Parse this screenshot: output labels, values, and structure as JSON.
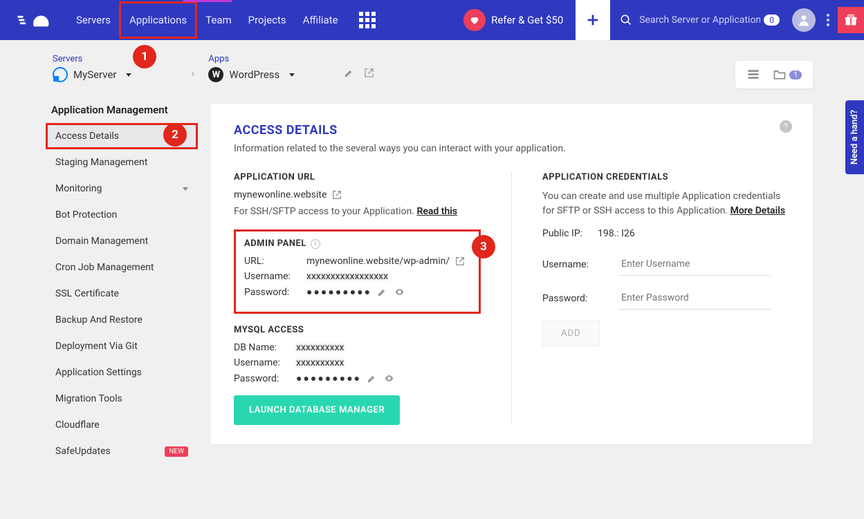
{
  "nav": {
    "links": [
      "Servers",
      "Applications",
      "Team",
      "Projects",
      "Affiliate"
    ],
    "refer": "Refer & Get $50",
    "search_placeholder": "Search Server or Application",
    "search_count": "0"
  },
  "crumb": {
    "servers_label": "Servers",
    "server_name": "MyServer",
    "apps_label": "Apps",
    "app_name": "WordPress",
    "folder_count": "1"
  },
  "callouts": {
    "c1": "1",
    "c2": "2",
    "c3": "3"
  },
  "sidebar": {
    "title": "Application Management",
    "items": [
      "Access Details",
      "Staging Management",
      "Monitoring",
      "Bot Protection",
      "Domain Management",
      "Cron Job Management",
      "SSL Certificate",
      "Backup And Restore",
      "Deployment Via Git",
      "Application Settings",
      "Migration Tools",
      "Cloudflare",
      "SafeUpdates"
    ],
    "new_badge": "NEW"
  },
  "panel": {
    "title": "ACCESS DETAILS",
    "sub": "Information related to the several ways you can interact with your application.",
    "app_url_title": "APPLICATION URL",
    "app_url": "mynewonline.website",
    "ssh_note": "For SSH/SFTP access to your Application. ",
    "read_this": "Read this",
    "admin_title": "ADMIN PANEL",
    "admin_url_label": "URL:",
    "admin_url": "mynewonline.website/wp-admin/",
    "username_label": "Username:",
    "admin_username_masked": "xxxxxxxxxxxxxxxxx",
    "password_label": "Password:",
    "password_dots": "●●●●●●●●●",
    "mysql_title": "MYSQL ACCESS",
    "db_name_label": "DB Name:",
    "db_name_masked": "xxxxxxxxxx",
    "mysql_user_masked": "xxxxxxxxxx",
    "launch_db": "LAUNCH DATABASE MANAGER",
    "cred_title": "APPLICATION CREDENTIALS",
    "cred_note": "You can create and use multiple Application credentials for SFTP or SSH access to this Application. ",
    "more_details": "More Details",
    "public_ip_label": "Public IP:",
    "public_ip": "198.:        I26",
    "user_ph": "Enter Username",
    "pass_ph": "Enter Password",
    "add_btn": "ADD"
  },
  "hand": "Need a hand?"
}
